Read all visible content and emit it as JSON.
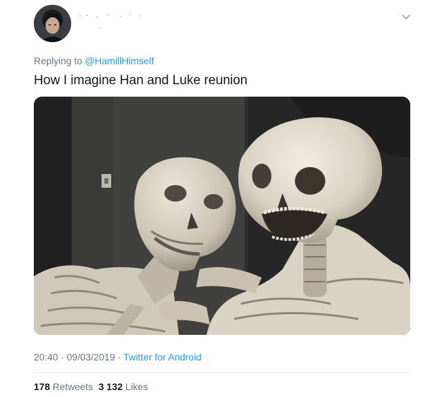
{
  "reply": {
    "prefix": "Replying to ",
    "handle": "@HamillHimself"
  },
  "tweet": {
    "text": "How I imagine Han and Luke reunion"
  },
  "meta": {
    "time": "20:40",
    "separator": " · ",
    "date": "09/03/2019",
    "separator2": " · ",
    "source": "Twitter for Android"
  },
  "stats": {
    "retweets_count": "178",
    "retweets_label": "Retweets",
    "likes_count": "3 132",
    "likes_label": "Likes"
  },
  "icons": {
    "menu": "chevron-down-icon"
  },
  "colors": {
    "link": "#1da1f2",
    "secondary_text": "#657786",
    "primary_text": "#14171a",
    "divider": "#e6ecf0"
  }
}
